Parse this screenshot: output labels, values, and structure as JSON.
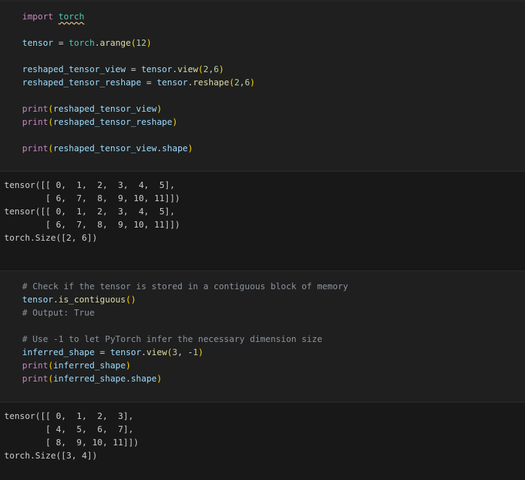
{
  "cells": [
    {
      "type": "code",
      "lines": [
        [
          [
            "kw",
            "import"
          ],
          [
            "pl",
            " "
          ],
          [
            "mod sq",
            "torch"
          ]
        ],
        [],
        [
          [
            "var",
            "tensor"
          ],
          [
            "op",
            " = "
          ],
          [
            "mod",
            "torch"
          ],
          [
            "pl",
            "."
          ],
          [
            "fn",
            "arange"
          ],
          [
            "par",
            "("
          ],
          [
            "num",
            "12"
          ],
          [
            "par",
            ")"
          ]
        ],
        [],
        [
          [
            "var",
            "reshaped_tensor_view"
          ],
          [
            "op",
            " = "
          ],
          [
            "var",
            "tensor"
          ],
          [
            "pl",
            "."
          ],
          [
            "fn",
            "view"
          ],
          [
            "par",
            "("
          ],
          [
            "num",
            "2"
          ],
          [
            "pl",
            ","
          ],
          [
            "num",
            "6"
          ],
          [
            "par",
            ")"
          ]
        ],
        [
          [
            "var",
            "reshaped_tensor_reshape"
          ],
          [
            "op",
            " = "
          ],
          [
            "var",
            "tensor"
          ],
          [
            "pl",
            "."
          ],
          [
            "fn",
            "reshape"
          ],
          [
            "par",
            "("
          ],
          [
            "num",
            "2"
          ],
          [
            "pl",
            ","
          ],
          [
            "num",
            "6"
          ],
          [
            "par",
            ")"
          ]
        ],
        [],
        [
          [
            "kw",
            "print"
          ],
          [
            "par",
            "("
          ],
          [
            "var",
            "reshaped_tensor_view"
          ],
          [
            "par",
            ")"
          ]
        ],
        [
          [
            "kw",
            "print"
          ],
          [
            "par",
            "("
          ],
          [
            "var",
            "reshaped_tensor_reshape"
          ],
          [
            "par",
            ")"
          ]
        ],
        [],
        [
          [
            "kw",
            "print"
          ],
          [
            "par",
            "("
          ],
          [
            "var",
            "reshaped_tensor_view"
          ],
          [
            "pl",
            "."
          ],
          [
            "var",
            "shape"
          ],
          [
            "par",
            ")"
          ]
        ]
      ]
    },
    {
      "type": "output",
      "lines": [
        "tensor([[ 0,  1,  2,  3,  4,  5],",
        "        [ 6,  7,  8,  9, 10, 11]])",
        "tensor([[ 0,  1,  2,  3,  4,  5],",
        "        [ 6,  7,  8,  9, 10, 11]])",
        "torch.Size([2, 6])"
      ]
    },
    {
      "type": "code",
      "lines": [
        [
          [
            "cm",
            "# Check if the tensor is stored in a contiguous block of memory"
          ]
        ],
        [
          [
            "var",
            "tensor"
          ],
          [
            "pl",
            "."
          ],
          [
            "fn",
            "is_contiguous"
          ],
          [
            "par",
            "()"
          ]
        ],
        [
          [
            "cm",
            "# Output: True"
          ]
        ],
        [],
        [
          [
            "cm",
            "# Use -1 to let PyTorch infer the necessary dimension size"
          ]
        ],
        [
          [
            "var",
            "inferred_shape"
          ],
          [
            "op",
            " = "
          ],
          [
            "var",
            "tensor"
          ],
          [
            "pl",
            "."
          ],
          [
            "fn",
            "view"
          ],
          [
            "par",
            "("
          ],
          [
            "num",
            "3"
          ],
          [
            "pl",
            ", "
          ],
          [
            "op",
            "-"
          ],
          [
            "num",
            "1"
          ],
          [
            "par",
            ")"
          ]
        ],
        [
          [
            "kw",
            "print"
          ],
          [
            "par",
            "("
          ],
          [
            "var",
            "inferred_shape"
          ],
          [
            "par",
            ")"
          ]
        ],
        [
          [
            "kw",
            "print"
          ],
          [
            "par",
            "("
          ],
          [
            "var",
            "inferred_shape"
          ],
          [
            "pl",
            "."
          ],
          [
            "var",
            "shape"
          ],
          [
            "par",
            ")"
          ]
        ]
      ]
    },
    {
      "type": "output",
      "lines": [
        "tensor([[ 0,  1,  2,  3],",
        "        [ 4,  5,  6,  7],",
        "        [ 8,  9, 10, 11]])",
        "torch.Size([3, 4])"
      ]
    }
  ]
}
